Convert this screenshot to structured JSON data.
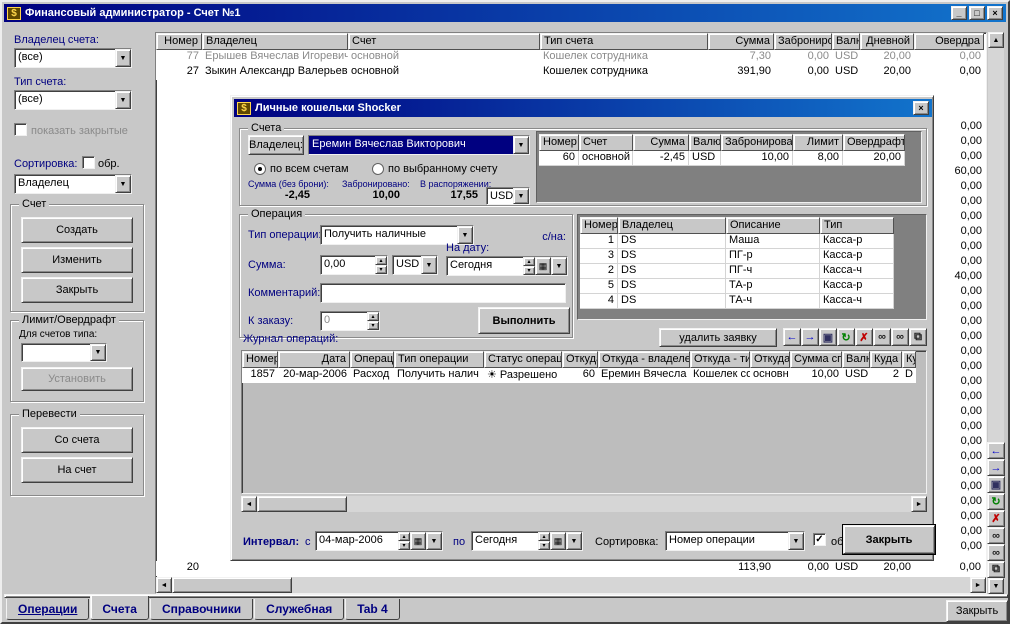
{
  "glyphs": {
    "dropdown": "▼",
    "scroll_up": "▲",
    "scroll_down": "▼",
    "scroll_left": "◄",
    "scroll_right": "►",
    "check": "✓",
    "spin_up": "▴",
    "spin_down": "▾",
    "calendar": "▦"
  },
  "window": {
    "title": "Финансовый администратор - Счет №1",
    "icon_glyph": "$",
    "minimize_glyph": "_",
    "maximize_glyph": "□",
    "close_glyph": "×"
  },
  "sidebar": {
    "owner_label": "Владелец счета:",
    "owner_value": "(все)",
    "type_label": "Тип счета:",
    "type_value": "(все)",
    "show_closed_label": "показать закрытые",
    "sort_label": "Сортировка:",
    "reverse_label": "обр.",
    "sort_value": "Владелец",
    "account_group": "Счет",
    "create_label": "Создать",
    "edit_label": "Изменить",
    "close_label": "Закрыть",
    "limit_group": "Лимит/Овердрафт",
    "for_accounts_label": "Для счетов типа:",
    "set_label": "Установить",
    "transfer_group": "Перевести",
    "from_account_label": "Со счета",
    "to_account_label": "На счет"
  },
  "accounts_table": {
    "headers": [
      "Номер",
      "Владелец",
      "Счет",
      "Тип счета",
      "Сумма",
      "Заброниро",
      "Валю",
      "Дневной",
      "Овердра"
    ],
    "rows": [
      [
        "77",
        "Ерышев Вячеслав Игоревич",
        "основной",
        "Кошелек сотрудника",
        "7,30",
        "0,00",
        "USD",
        "20,00",
        "0,00"
      ],
      [
        "27",
        "Зыкин Александр Валерьевич",
        "основной",
        "Кошелек сотрудника",
        "391,90",
        "0,00",
        "USD",
        "20,00",
        "0,00"
      ]
    ],
    "gray_rows": [
      0
    ],
    "bottom_row": {
      "rows": [
        [
          "20",
          "",
          "",
          "",
          "113,90",
          "0,00",
          "USD",
          "20,00",
          "0,00"
        ]
      ]
    },
    "edge_values": [
      "0,00",
      "0,00",
      "0,00",
      "60,00",
      "0,00",
      "0,00",
      "0,00",
      "0,00",
      "0,00",
      "0,00",
      "40,00",
      "0,00",
      "0,00",
      "0,00",
      "0,00",
      "0,00",
      "0,00",
      "0,00",
      "0,00",
      "0,00",
      "0,00",
      "0,00",
      "0,00",
      "0,00",
      "0,00",
      "0,00",
      "0,00",
      "0,00",
      "0,00"
    ]
  },
  "dialog": {
    "title": "Личные кошельки Shocker",
    "icon_glyph": "$",
    "close_glyph": "×",
    "accounts": {
      "group_label": "Счета",
      "owner_button": "Владелец:",
      "owner_value": "Еремин Вячеслав Викторович",
      "radio_all": "по всем счетам",
      "radio_selected": "по выбранному счету",
      "sum_label": "Сумма (без брони):",
      "sum_value": "-2,45",
      "reserved_label": "Забронировано:",
      "reserved_value": "10,00",
      "available_label": "В распоряжении:",
      "available_value": "17,55",
      "currency_value": "USD",
      "table": {
        "headers": [
          "Номер",
          "Счет",
          "Сумма",
          "Валю",
          "Забронирован",
          "Лимит",
          "Овердрафт"
        ],
        "rows": [
          [
            "60",
            "основной",
            "-2,45",
            "USD",
            "10,00",
            "8,00",
            "20,00"
          ]
        ]
      }
    },
    "operation": {
      "group_label": "Операция",
      "type_label": "Тип операции:",
      "type_value": "Получить наличные",
      "target_label": "с/на:",
      "amount_label": "Сумма:",
      "amount_value": "0,00",
      "currency_value": "USD",
      "date_label": "На дату:",
      "date_value": "Сегодня",
      "comment_label": "Комментарий:",
      "comment_value": "",
      "order_label": "К заказу:",
      "order_value": "0",
      "execute_label": "Выполнить",
      "targets_table": {
        "headers": [
          "Номер",
          "Владелец",
          "Описание",
          "Тип"
        ],
        "rows": [
          [
            "1",
            "DS",
            "Маша",
            "Касса-р"
          ],
          [
            "3",
            "DS",
            "ПГ-р",
            "Касса-р"
          ],
          [
            "2",
            "DS",
            "ПГ-ч",
            "Касса-ч"
          ],
          [
            "5",
            "DS",
            "ТА-р",
            "Касса-р"
          ],
          [
            "4",
            "DS",
            "ТА-ч",
            "Касса-ч"
          ]
        ]
      }
    },
    "journal": {
      "label": "Журнал операций:",
      "delete_request_label": "удалить заявку",
      "table": {
        "headers": [
          "Номер",
          "Дата",
          "Операци",
          "Тип операции",
          "Статус операц",
          "Откуда",
          "Откуда - владелец",
          "Откуда - тип",
          "Откуда",
          "Сумма сп",
          "Валю",
          "Куда -",
          "Ку"
        ],
        "rows": [
          [
            "1857",
            "20-мар-2006",
            "Расход",
            "Получить налич",
            "☀ Разрешено",
            "60",
            "Еремин Вячесла",
            "Кошелек со",
            "основн",
            "10,00",
            "USD",
            "2",
            "D"
          ]
        ]
      }
    },
    "toolbar": [
      {
        "name": "prev-icon",
        "glyph": "←",
        "color": "#0000cc"
      },
      {
        "name": "next-icon",
        "glyph": "→",
        "color": "#0000cc"
      },
      {
        "name": "save-icon",
        "glyph": "▣",
        "color": "#303060"
      },
      {
        "name": "refresh-icon",
        "glyph": "↻",
        "color": "#008000"
      },
      {
        "name": "delete-icon",
        "glyph": "✗",
        "color": "#c00000"
      },
      {
        "name": "find-icon",
        "glyph": "∞",
        "color": "#202020"
      },
      {
        "name": "find-next-icon",
        "glyph": "∞",
        "color": "#202020"
      },
      {
        "name": "copy-icon",
        "glyph": "⧉",
        "color": "#202020"
      }
    ],
    "footer": {
      "interval_label": "Интервал:",
      "from_label": "с",
      "from_value": "04-мар-2006",
      "to_label": "по",
      "to_value": "Сегодня",
      "sort_label": "Сортировка:",
      "sort_value": "Номер операции",
      "reverse_label": "обр.",
      "close_label": "Закрыть"
    }
  },
  "tabs": {
    "items": [
      {
        "label": "Операции"
      },
      {
        "label": "Счета"
      },
      {
        "label": "Справочники"
      },
      {
        "label": "Служебная"
      },
      {
        "label": "Tab 4"
      }
    ],
    "active_index": 1
  },
  "bottom": {
    "close_label": "Закрыть"
  }
}
